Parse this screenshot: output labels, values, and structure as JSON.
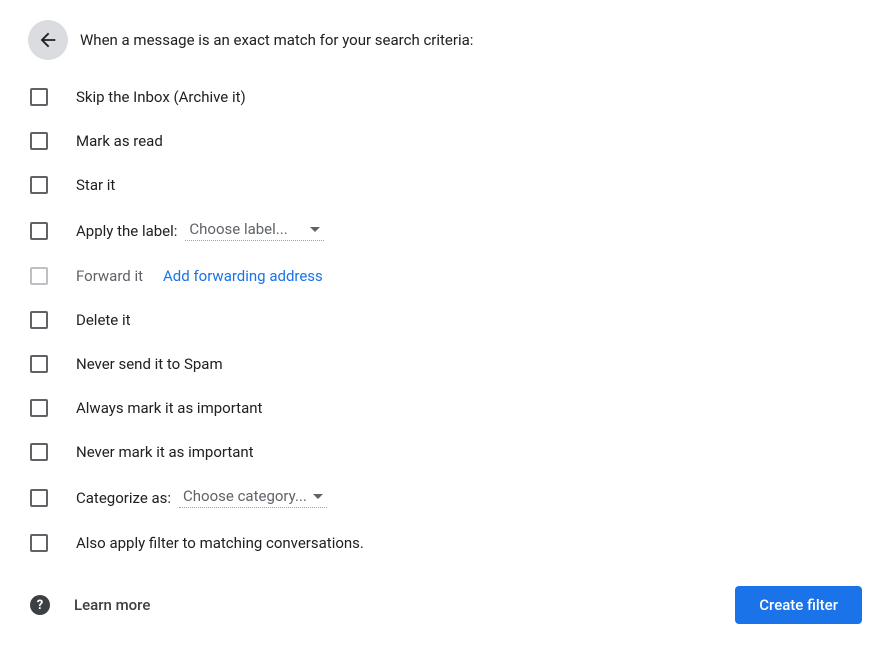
{
  "header": {
    "text": "When a message is an exact match for your search criteria:"
  },
  "options": {
    "skip_inbox": "Skip the Inbox (Archive it)",
    "mark_read": "Mark as read",
    "star_it": "Star it",
    "apply_label": "Apply the label:",
    "apply_label_dropdown": "Choose label...",
    "forward_it": "Forward it",
    "forward_link": "Add forwarding address",
    "delete_it": "Delete it",
    "never_spam": "Never send it to Spam",
    "always_important": "Always mark it as important",
    "never_important": "Never mark it as important",
    "categorize_as": "Categorize as:",
    "categorize_dropdown": "Choose category...",
    "also_apply": "Also apply filter to matching conversations."
  },
  "footer": {
    "learn_more": "Learn more",
    "create_filter": "Create filter"
  }
}
